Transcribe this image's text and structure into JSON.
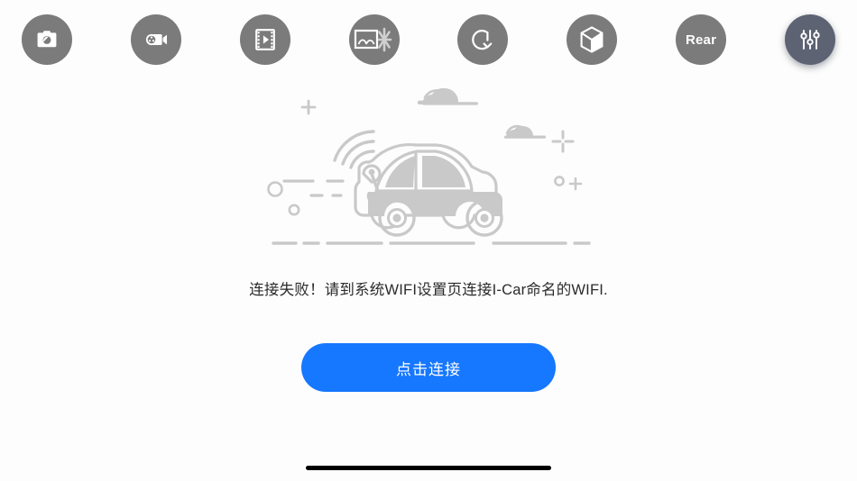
{
  "screen": {
    "background_color": "#fdfdfd",
    "accent_color": "#1677ff",
    "icon_circle_color": "#7b7b7b",
    "icon_selected_color": "#5d6373",
    "illustration_color": "#c9c9c9"
  },
  "toolbar": {
    "items": [
      {
        "name": "photo-capture",
        "icon": "camera-icon",
        "label": "",
        "selected": false
      },
      {
        "name": "video-record",
        "icon": "video-camera-icon",
        "label": "",
        "selected": false
      },
      {
        "name": "video-gallery",
        "icon": "film-play-icon",
        "label": "",
        "selected": false
      },
      {
        "name": "photo-effects",
        "icon": "image-sparkle-icon",
        "label": "",
        "selected": false
      },
      {
        "name": "rotate-view",
        "icon": "rotate-icon",
        "label": "",
        "selected": false
      },
      {
        "name": "three-d-view",
        "icon": "cube-icon",
        "label": "",
        "selected": false
      },
      {
        "name": "rear-camera",
        "icon": "text-icon",
        "label": "Rear",
        "selected": false
      },
      {
        "name": "settings",
        "icon": "sliders-icon",
        "label": "",
        "selected": true
      }
    ]
  },
  "illustration": {
    "alt_name": "car-wifi-illustration"
  },
  "main": {
    "message": "连接失败！请到系统WIFI设置页连接I-Car命名的WIFI.",
    "connect_button_label": "点击连接"
  },
  "system": {
    "home_indicator": ""
  }
}
